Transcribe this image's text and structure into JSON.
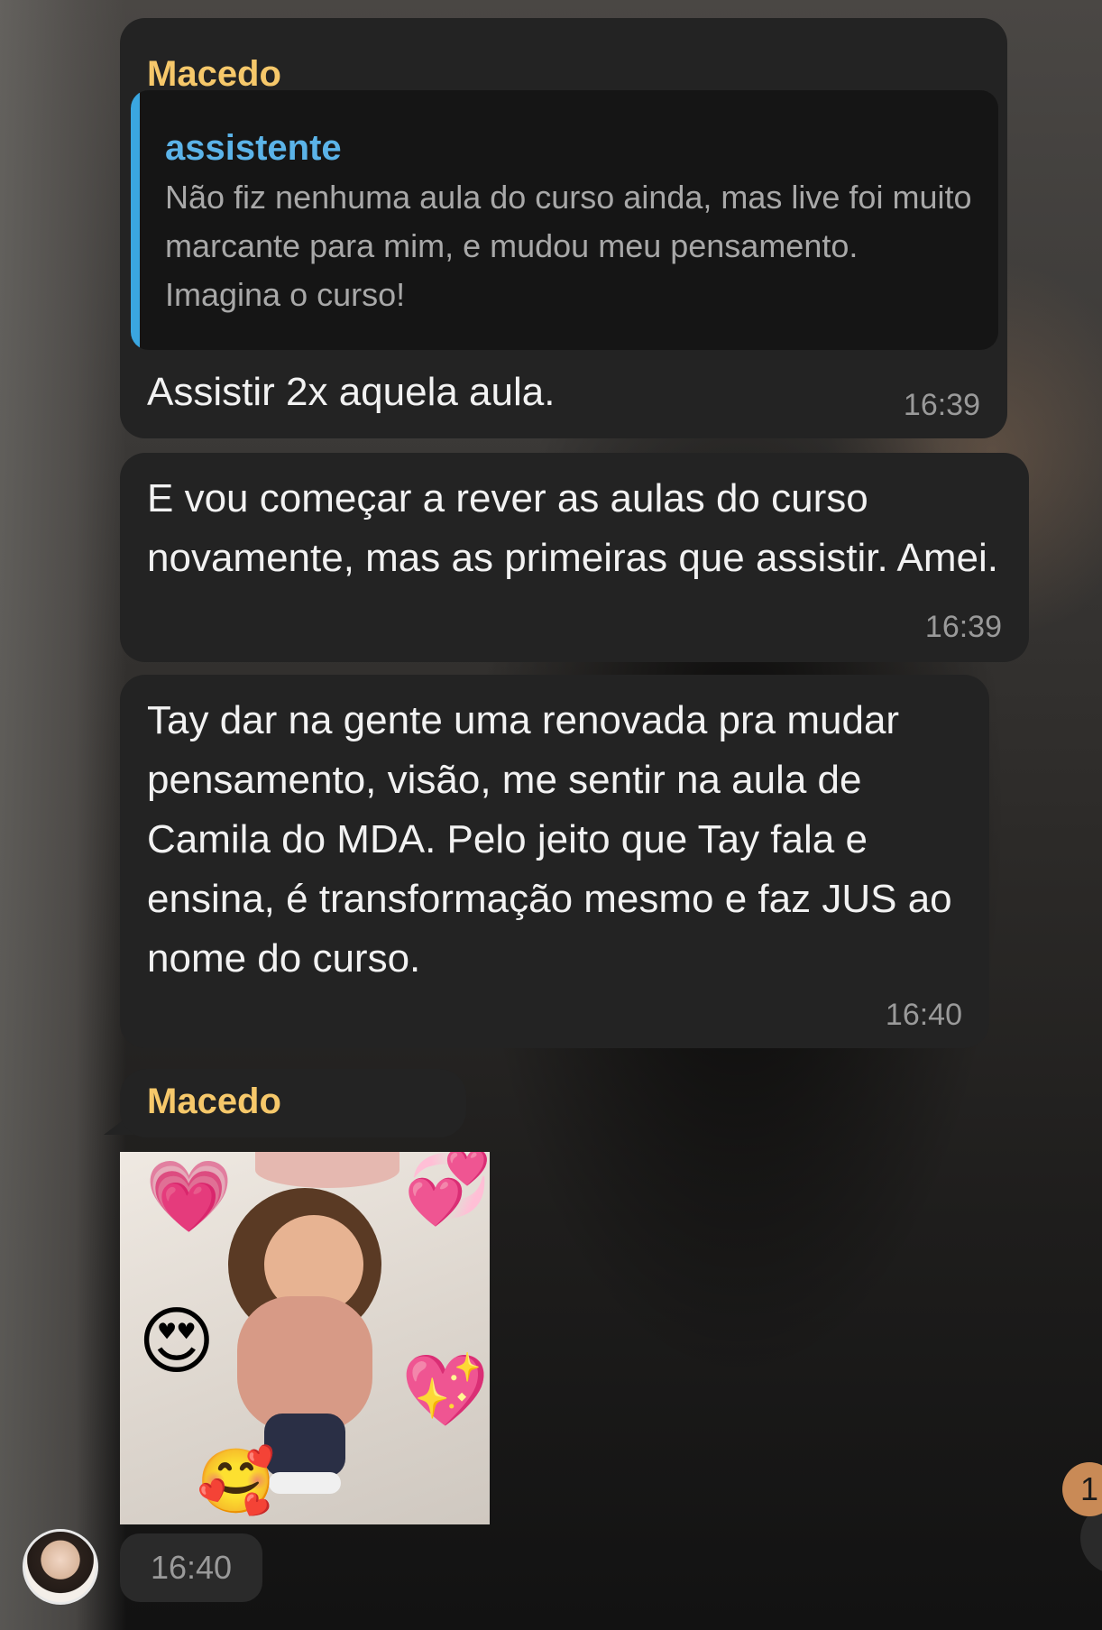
{
  "messages": [
    {
      "sender": "Macedo",
      "reply": {
        "name": "assistente",
        "text": "Não fiz nenhuma aula do curso ainda, mas live foi muito marcante para mim, e mudou meu pensamento. Imagina o curso!"
      },
      "text": "Assistir 2x aquela aula.",
      "time": "16:39"
    },
    {
      "text": "E vou começar a rever as aulas do curso novamente, mas as primeiras que assistir. Amei.",
      "time": "16:39"
    },
    {
      "text": "Tay dar na gente uma renovada pra mudar pensamento, visão, me sentir na aula de Camila do MDA. Pelo jeito que Tay fala e ensina, é transformação mesmo e faz JUS ao nome do curso.",
      "time": "16:40"
    },
    {
      "sender": "Macedo",
      "image_label": "child-photo-with-heart-emojis",
      "emojis": [
        "💗",
        "💞",
        "😍",
        "💖",
        "🥰"
      ],
      "time": "16:40"
    }
  ],
  "unread_count": "1",
  "colors": {
    "bubble": "#232323",
    "sender": "#f6c86a",
    "reply_accent": "#3aa6e0",
    "unread_badge": "#c98a56"
  }
}
